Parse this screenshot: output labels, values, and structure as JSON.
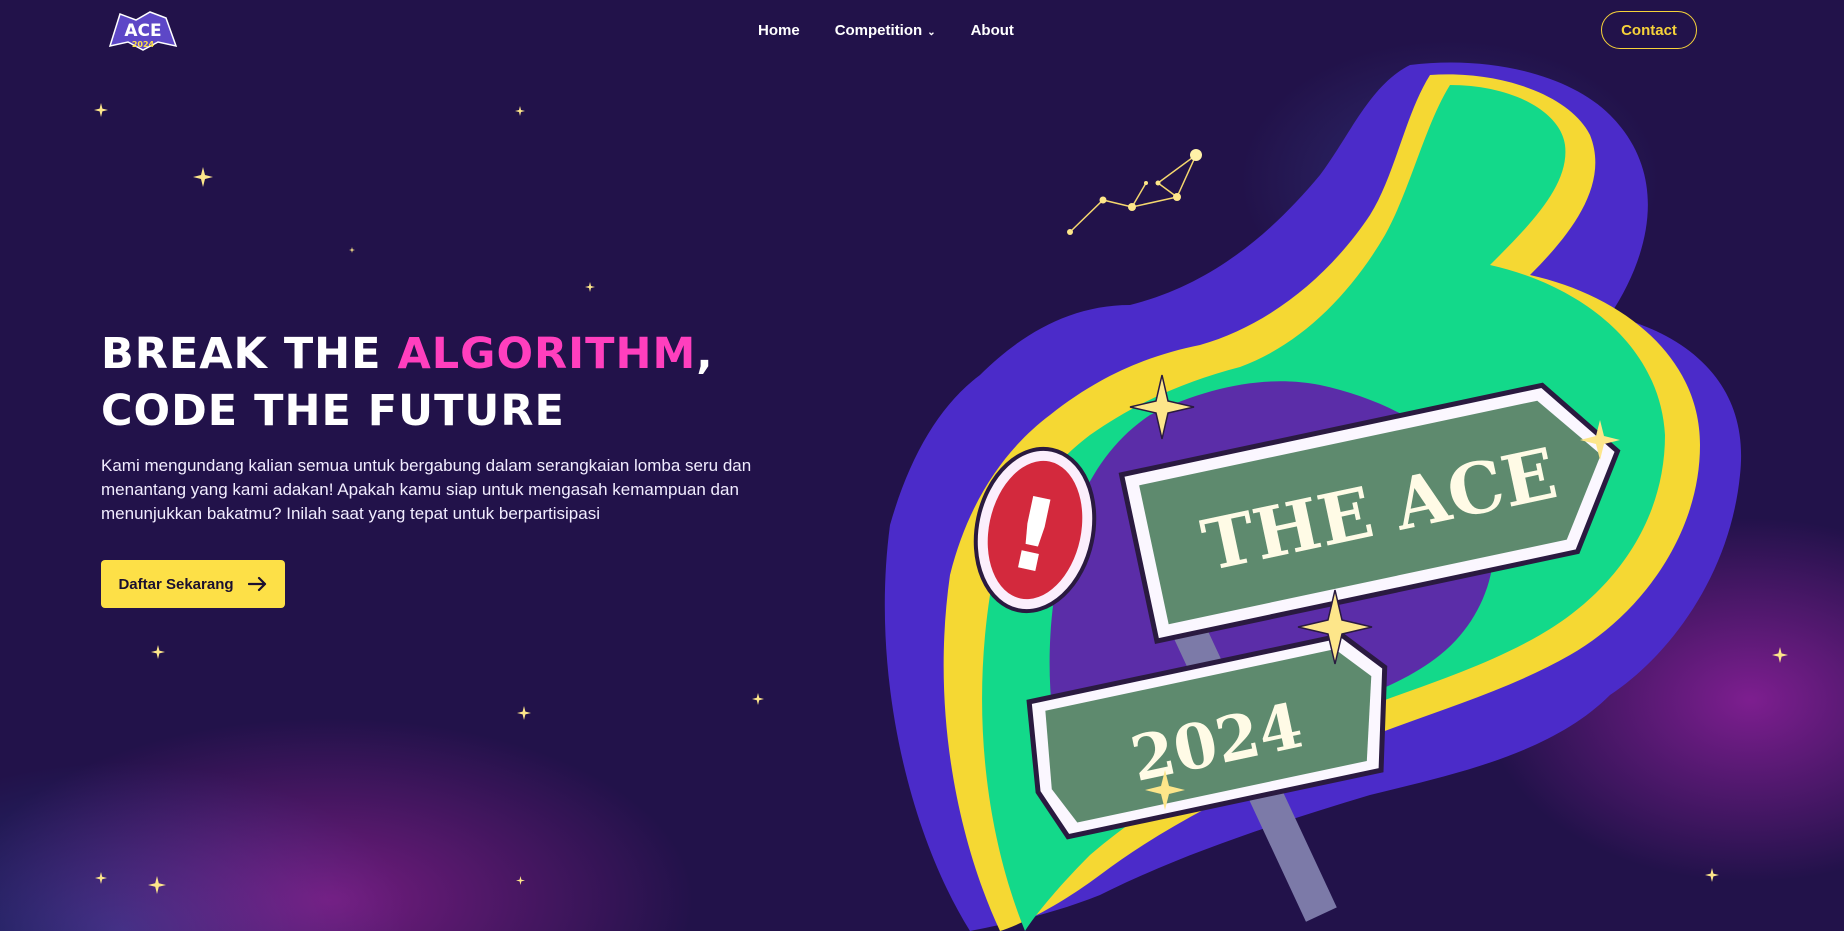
{
  "nav": {
    "logo_text": "ACE",
    "logo_year": "2024",
    "links": {
      "home": "Home",
      "competition": "Competition",
      "about": "About"
    },
    "contact_label": "Contact",
    "dropdown_icon": "chevron-down-icon"
  },
  "hero": {
    "title_part1": "Break the ",
    "title_highlight": "Algorithm",
    "title_part2": ",",
    "title_line2": "Code the Future",
    "description": "Kami mengundang kalian semua untuk bergabung dalam serangkaian lomba seru dan menantang yang kami adakan! Apakah kamu siap untuk mengasah kemampuan dan menunjukkan bakatmu? Inilah saat yang tepat untuk berpartisipasi",
    "cta_label": "Daftar Sekarang",
    "cta_icon": "arrow-right-icon"
  },
  "art": {
    "sign_text": "THE ACE",
    "sign_year": "2024",
    "warning_glyph": "!"
  },
  "colors": {
    "background": "#22124a",
    "accent_yellow": "#fde047",
    "highlight_pink": "#ff3fbe",
    "green": "#13d98a",
    "purple": "#4b2bc9"
  }
}
